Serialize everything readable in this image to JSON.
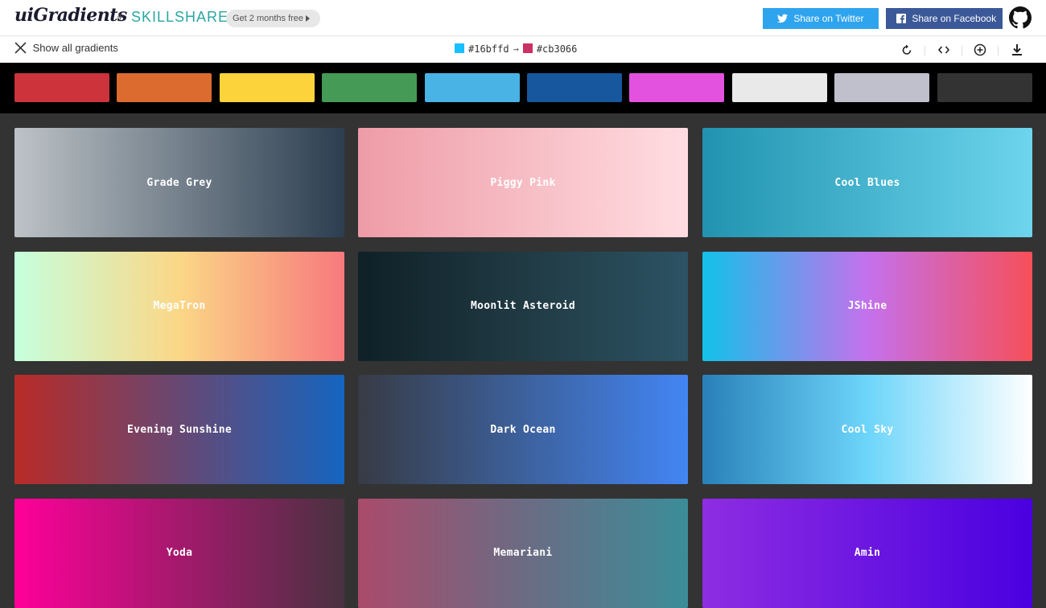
{
  "header": {
    "logo_text": "uiGradients",
    "plus": "+",
    "partner": "SKILLSHARE",
    "promo_label": "Get 2 months free",
    "twitter_label": "Share on Twitter",
    "facebook_label": "Share on Facebook",
    "icons": [
      "twitter-icon",
      "facebook-icon",
      "github-icon"
    ],
    "colors": {
      "twitter": "#2fa4ee",
      "facebook": "#3b5898",
      "skillshare": "#2aa6a3"
    }
  },
  "toolbar": {
    "show_all_label": "Show all gradients",
    "from_hex": "#16bffd",
    "arrow": "→",
    "to_hex": "#cb3066",
    "icons": [
      "rotate-icon",
      "code-icon",
      "add-icon",
      "download-icon"
    ]
  },
  "palette": [
    {
      "name": "red",
      "color": "#cc333b"
    },
    {
      "name": "orange",
      "color": "#dc6b2f"
    },
    {
      "name": "yellow",
      "color": "#fdd33b"
    },
    {
      "name": "green",
      "color": "#459a56"
    },
    {
      "name": "cyan",
      "color": "#49b3e6"
    },
    {
      "name": "blue",
      "color": "#16579d"
    },
    {
      "name": "magenta",
      "color": "#e352df"
    },
    {
      "name": "white",
      "color": "#e9e9e9"
    },
    {
      "name": "grey",
      "color": "#c0c0cc"
    },
    {
      "name": "black",
      "color": "#333333"
    }
  ],
  "gradients": [
    {
      "name": "Grade Grey",
      "colors": [
        "#bdc3c7",
        "#2c3e50"
      ]
    },
    {
      "name": "Piggy Pink",
      "colors": [
        "#ee9ca7",
        "#ffdde1"
      ]
    },
    {
      "name": "Cool Blues",
      "colors": [
        "#2193b0",
        "#6dd5ed"
      ]
    },
    {
      "name": "MegaTron",
      "colors": [
        "#c6ffdd",
        "#fbd786",
        "#f7797d"
      ]
    },
    {
      "name": "Moonlit Asteroid",
      "colors": [
        "#0f2027",
        "#203a43",
        "#2c5364"
      ]
    },
    {
      "name": "JShine",
      "colors": [
        "#12c2e9",
        "#c471ed",
        "#f64f59"
      ]
    },
    {
      "name": "Evening Sunshine",
      "colors": [
        "#b92b27",
        "#1565c0"
      ]
    },
    {
      "name": "Dark Ocean",
      "colors": [
        "#373b44",
        "#4286f4"
      ]
    },
    {
      "name": "Cool Sky",
      "colors": [
        "#2980b9",
        "#6dd5fa",
        "#ffffff"
      ]
    },
    {
      "name": "Yoda",
      "colors": [
        "#ff0099",
        "#493240"
      ]
    },
    {
      "name": "Memariani",
      "colors": [
        "#aa4b6b",
        "#6b6b83",
        "#3b8d99"
      ]
    },
    {
      "name": "Amin",
      "colors": [
        "#8e2de2",
        "#4a00e0"
      ]
    }
  ]
}
